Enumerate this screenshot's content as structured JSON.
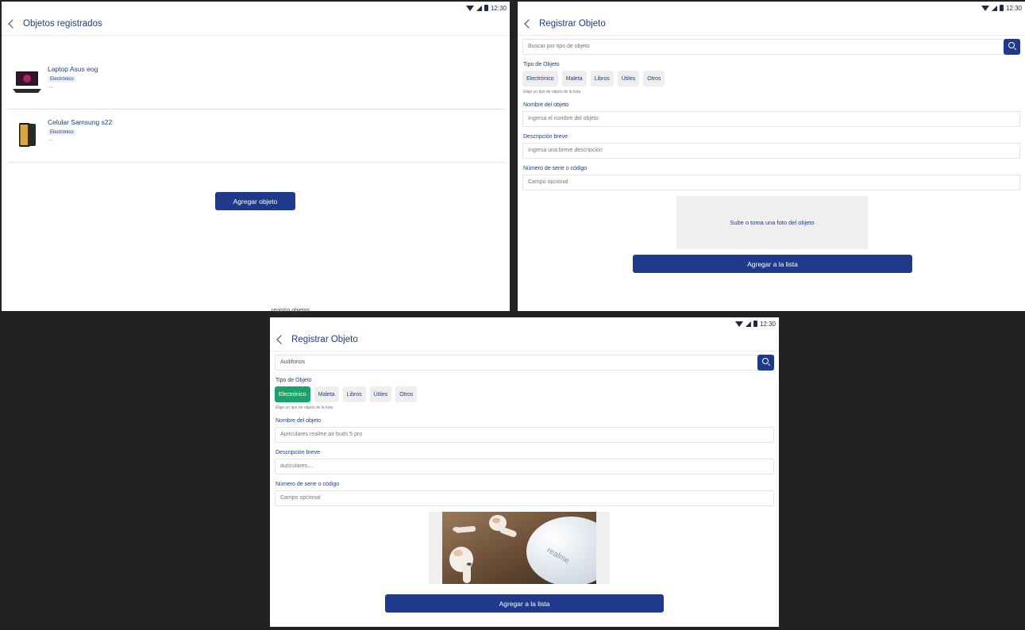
{
  "status": {
    "time": "12:30"
  },
  "list_screen": {
    "title": "Objetos registrados",
    "items": [
      {
        "name": "Laptop Asus eog",
        "category": "Electrónico",
        "description": "....",
        "icon": "laptop-image"
      },
      {
        "name": "Celular Samsung s22",
        "category": "Electrónico",
        "description": "....",
        "icon": "phone-image"
      }
    ],
    "add_button": "Agregar objeto"
  },
  "caption": "registro objetos",
  "form_empty": {
    "title": "Registrar Objeto",
    "search_placeholder": "Buscar por tipo de objeto",
    "type_label": "Tipo de Objeto",
    "types": [
      "Electrónico",
      "Maleta",
      "Libros",
      "Útiles",
      "Otros"
    ],
    "type_helper": "Elige un tipo de objeto de la lista",
    "name_label": "Nombre del objeto",
    "name_placeholder": "Ingresa el nombre del objeto",
    "desc_label": "Descripción breve",
    "desc_placeholder": "Ingresa una breve descripción",
    "serial_label": "Número de serie o código",
    "serial_placeholder": "Campo opcional",
    "photo_prompt": "Sube o toma una foto del objeto",
    "submit": "Agregar a la lista"
  },
  "form_filled": {
    "title": "Registrar Objeto",
    "search_value": "Audifonos",
    "type_label": "Tipo de Objeto",
    "types": [
      "Electrónico",
      "Maleta",
      "Libros",
      "Útiles",
      "Otros"
    ],
    "selected_type": "Electrónico",
    "type_helper": "Elige un tipo de objeto de la lista",
    "name_label": "Nombre del objeto",
    "name_value": "Auriculares realme air buds 5 pro",
    "desc_label": "Descripción breve",
    "desc_value": "auriculares....",
    "serial_label": "Número de serie o código",
    "serial_placeholder": "Campo opcional",
    "photo_brand": "realme",
    "submit": "Agregar a la lista"
  },
  "colors": {
    "primary": "#1f3a8a",
    "selected_chip": "#1ba26a",
    "background": "#222222"
  }
}
